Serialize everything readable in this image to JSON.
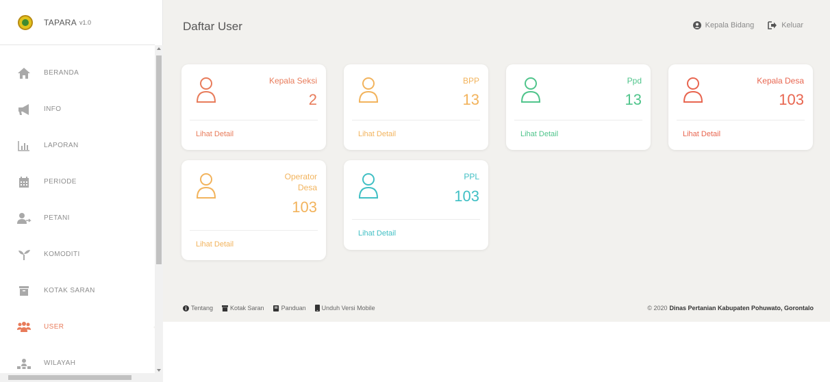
{
  "app": {
    "name": "TAPARA",
    "version": "v1.0"
  },
  "header": {
    "title": "Daftar User",
    "user_label": "Kepala Bidang",
    "logout_label": "Keluar"
  },
  "sidebar": {
    "items": [
      {
        "label": "BERANDA",
        "icon": "home-icon"
      },
      {
        "label": "INFO",
        "icon": "megaphone-icon"
      },
      {
        "label": "LAPORAN",
        "icon": "bar-chart-icon"
      },
      {
        "label": "PERIODE",
        "icon": "calendar-icon"
      },
      {
        "label": "PETANI",
        "icon": "farmer-icon"
      },
      {
        "label": "KOMODITI",
        "icon": "seedling-icon"
      },
      {
        "label": "KOTAK SARAN",
        "icon": "archive-box-icon"
      },
      {
        "label": "USER",
        "icon": "users-icon",
        "active": true
      },
      {
        "label": "WILAYAH",
        "icon": "region-icon"
      }
    ]
  },
  "cards": [
    {
      "title": "Kepala Seksi",
      "count": "2",
      "detail": "Lihat Detail",
      "color": "#e87b5a"
    },
    {
      "title": "BPP",
      "count": "13",
      "detail": "Lihat Detail",
      "color": "#f2b35c"
    },
    {
      "title": "Ppd",
      "count": "13",
      "detail": "Lihat Detail",
      "color": "#4fc48b"
    },
    {
      "title": "Kepala Desa",
      "count": "103",
      "detail": "Lihat Detail",
      "color": "#e8654f"
    },
    {
      "title_line1": "Operator",
      "title_line2": "Desa",
      "count": "103",
      "detail": "Lihat Detail",
      "color": "#f2b35c"
    },
    {
      "title": "PPL",
      "count": "103",
      "detail": "Lihat Detail",
      "color": "#3fbfc4"
    }
  ],
  "footer": {
    "links": [
      {
        "label": "Tentang",
        "icon": "info-circle-icon"
      },
      {
        "label": "Kotak Saran",
        "icon": "inbox-icon"
      },
      {
        "label": "Panduan",
        "icon": "book-icon"
      },
      {
        "label": "Unduh Versi Mobile",
        "icon": "mobile-icon"
      }
    ],
    "copyright_prefix": "© 2020",
    "copyright_org": "Dinas Pertanian Kabupaten Pohuwato, Gorontalo"
  }
}
